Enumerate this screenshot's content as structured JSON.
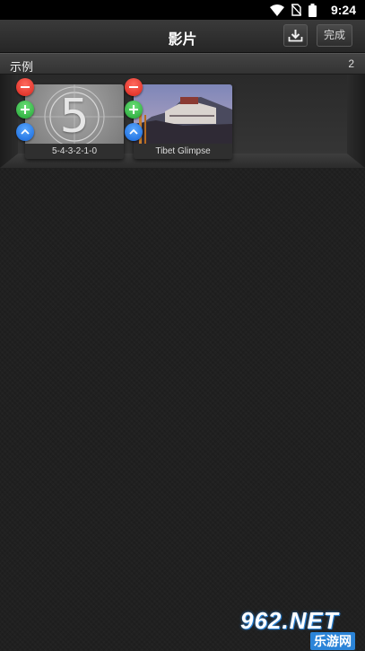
{
  "status_bar": {
    "time": "9:24",
    "icons": [
      "wifi-icon",
      "no-sim-icon",
      "battery-icon"
    ]
  },
  "title_bar": {
    "title": "影片",
    "download_icon": "download-icon",
    "done_label": "完成"
  },
  "section": {
    "title": "示例",
    "count": "2"
  },
  "clips": [
    {
      "label": "5-4-3-2-1-0",
      "thumb_text": "5",
      "thumb": "countdown"
    },
    {
      "label": "Tibet Glimpse",
      "thumb": "palace-photo"
    }
  ],
  "controls": {
    "remove_icon": "minus-icon",
    "add_icon": "plus-icon",
    "move_icon": "chevron-up-icon"
  },
  "colors": {
    "remove": "#e4342a",
    "add": "#2fbf45",
    "move": "#1f74e6",
    "watermark": "#2b84d8"
  },
  "watermark": {
    "top": "962.NET",
    "bottom": "乐游网"
  }
}
